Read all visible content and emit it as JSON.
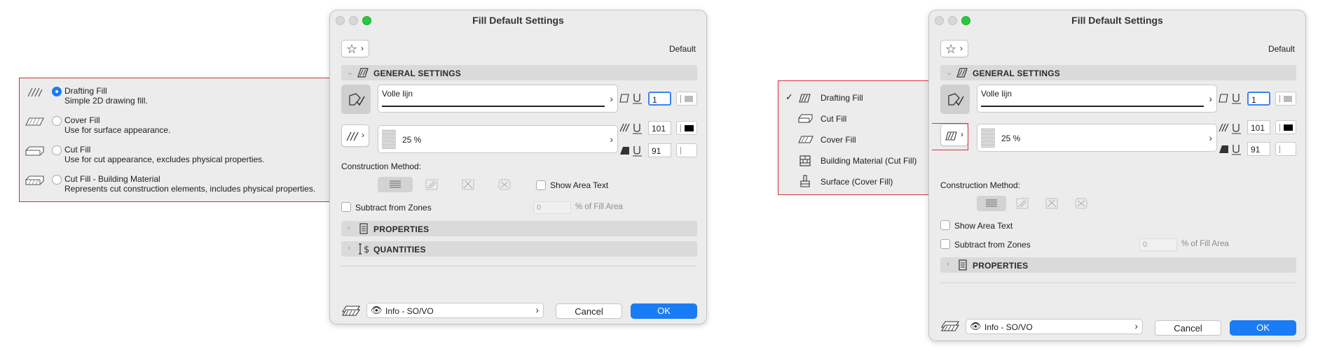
{
  "dialog": {
    "title": "Fill Default Settings",
    "default_label": "Default",
    "general_settings": "GENERAL SETTINGS",
    "line_type": "Volle lijn",
    "pen_value": "1",
    "pattern_value": "25 %",
    "fg_pen": "101",
    "bg_pen": "91",
    "construction_method": "Construction Method:",
    "show_area_text": "Show Area Text",
    "subtract_from_zones": "Subtract from Zones",
    "zone_percent": "0",
    "fill_area": "% of Fill Area",
    "properties": "PROPERTIES",
    "quantities": "QUANTITIES",
    "info_layer": "Info -  SO/VO",
    "cancel": "Cancel",
    "ok": "OK"
  },
  "left_callout": {
    "options": [
      {
        "title": "Drafting Fill",
        "desc": "Simple 2D drawing fill.",
        "selected": true
      },
      {
        "title": "Cover Fill",
        "desc": "Use for surface appearance.",
        "selected": false
      },
      {
        "title": "Cut Fill",
        "desc": "Use for cut appearance, excludes physical properties.",
        "selected": false
      },
      {
        "title": "Cut Fill - Building Material",
        "desc": "Represents cut construction elements, includes physical properties.",
        "selected": false
      }
    ]
  },
  "right_callout": {
    "checkmark": "✓",
    "options": [
      {
        "label": "Drafting Fill",
        "checked": true
      },
      {
        "label": "Cut Fill",
        "checked": false
      },
      {
        "label": "Cover Fill",
        "checked": false
      },
      {
        "label": "Building Material (Cut Fill)",
        "checked": false
      },
      {
        "label": "Surface (Cover Fill)",
        "checked": false
      }
    ]
  },
  "colors": {
    "accent": "#1a7cf5",
    "callout_border": "#d0313b",
    "panel_bg": "#ececec"
  }
}
